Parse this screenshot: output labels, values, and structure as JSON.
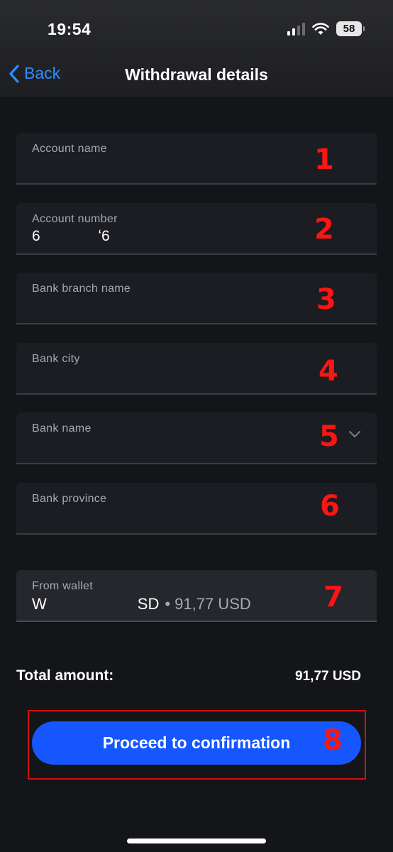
{
  "status_bar": {
    "time": "19:54",
    "battery": "58",
    "icons": [
      "signal-icon",
      "wifi-icon",
      "battery-icon"
    ]
  },
  "nav": {
    "back_label": "Back",
    "title": "Withdrawal details"
  },
  "fields": [
    {
      "label": "Account name",
      "value": "",
      "marker": "1"
    },
    {
      "label": "Account number",
      "value": "6              ʻ6",
      "marker": "2"
    },
    {
      "label": "Bank branch name",
      "value": "",
      "marker": "3"
    },
    {
      "label": "Bank city",
      "value": "",
      "marker": "4"
    },
    {
      "label": "Bank name",
      "value": "",
      "marker": "5"
    },
    {
      "label": "Bank province",
      "value": "",
      "marker": "6"
    }
  ],
  "wallet": {
    "label": "From wallet",
    "prefix": "W",
    "suffix": "SD",
    "balance": "• 91,77 USD",
    "marker": "7"
  },
  "total": {
    "label": "Total amount:",
    "value": "91,77 USD"
  },
  "cta": {
    "label": "Proceed to confirmation",
    "marker": "8"
  },
  "colors": {
    "accent": "#1556ff",
    "link": "#2f8cff",
    "annotation": "#ff1414",
    "background": "#141519"
  }
}
